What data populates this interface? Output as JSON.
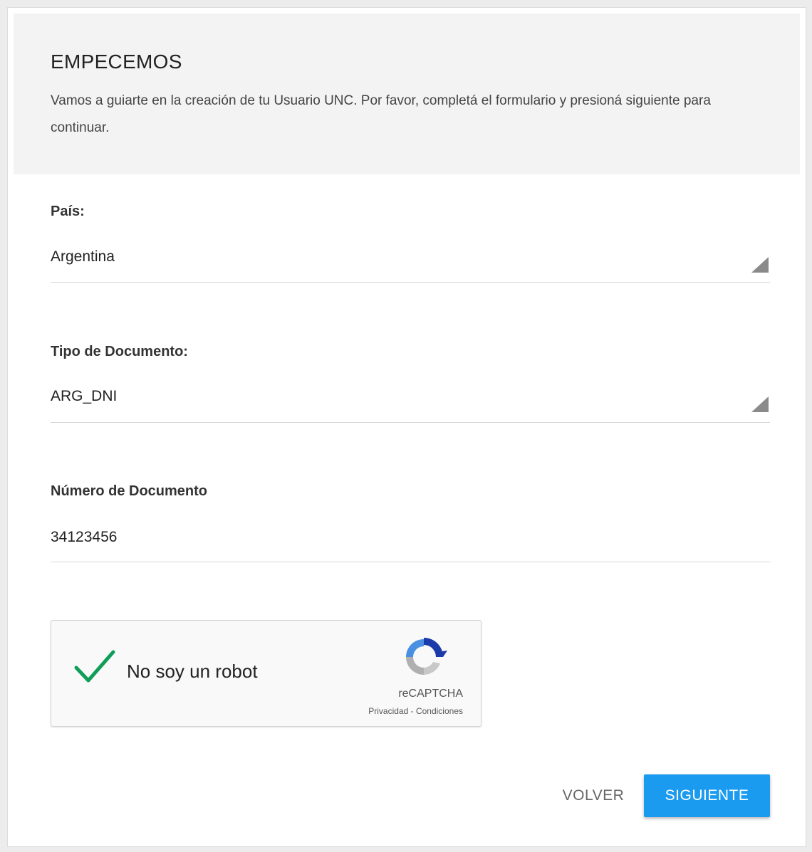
{
  "header": {
    "title": "EMPECEMOS",
    "subtitle": "Vamos a guiarte en la creación de tu Usuario UNC. Por favor, completá el formulario y presioná siguiente para continuar."
  },
  "form": {
    "country": {
      "label": "País:",
      "value": "Argentina"
    },
    "doc_type": {
      "label": "Tipo de Documento:",
      "value": "ARG_DNI"
    },
    "doc_number": {
      "label": "Número de Documento",
      "value": "34123456"
    }
  },
  "captcha": {
    "label": "No soy un robot",
    "brand": "reCAPTCHA",
    "links": "Privacidad - Condiciones",
    "checked": true,
    "check_color": "#0f9d58",
    "check_icon": "check-icon",
    "logo_icon": "recaptcha-logo-icon"
  },
  "actions": {
    "back_label": "VOLVER",
    "next_label": "SIGUIENTE"
  },
  "colors": {
    "primary": "#1a9bf0",
    "header_bg": "#f3f3f3"
  }
}
